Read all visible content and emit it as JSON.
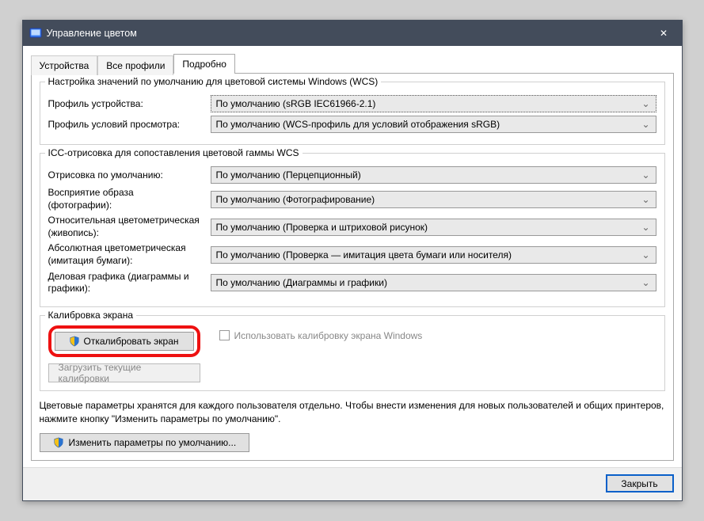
{
  "window": {
    "title": "Управление цветом",
    "close_label": "✕"
  },
  "tabs": {
    "devices": "Устройства",
    "all_profiles": "Все профили",
    "advanced": "Подробно"
  },
  "group1": {
    "legend": "Настройка значений по умолчанию для цветовой системы Windows (WCS)",
    "device_profile_label": "Профиль устройства:",
    "device_profile_value": "По умолчанию (sRGB IEC61966-2.1)",
    "viewing_profile_label": "Профиль условий просмотра:",
    "viewing_profile_value": "По умолчанию (WCS-профиль для условий отображения sRGB)"
  },
  "group2": {
    "legend": "ICC-отрисовка для сопоставления цветовой гаммы WCS",
    "r1_label": "Отрисовка по умолчанию:",
    "r1_value": "По умолчанию (Перцепционный)",
    "r2_label_a": "Восприятие образа",
    "r2_label_b": "(фотографии):",
    "r2_value": "По умолчанию (Фотографирование)",
    "r3_label_a": "Относительная цветометрическая",
    "r3_label_b": "(живопись):",
    "r3_value": "По умолчанию (Проверка и штриховой рисунок)",
    "r4_label_a": "Абсолютная цветометрическая",
    "r4_label_b": "(имитация бумаги):",
    "r4_value": "По умолчанию (Проверка — имитация цвета бумаги или носителя)",
    "r5_label_a": "Деловая графика (диаграммы и",
    "r5_label_b": "графики):",
    "r5_value": "По умолчанию (Диаграммы и графики)"
  },
  "group3": {
    "legend": "Калибровка экрана",
    "calibrate_btn": "Откалибровать экран",
    "load_btn": "Загрузить текущие калибровки",
    "use_windows_calib": "Использовать калибровку экрана Windows"
  },
  "note": "Цветовые параметры хранятся для каждого пользователя отдельно. Чтобы внести изменения для новых пользователей и общих принтеров, нажмите кнопку \"Изменить параметры по умолчанию\".",
  "defaults_btn": "Изменить параметры по умолчанию...",
  "footer": {
    "close": "Закрыть"
  }
}
